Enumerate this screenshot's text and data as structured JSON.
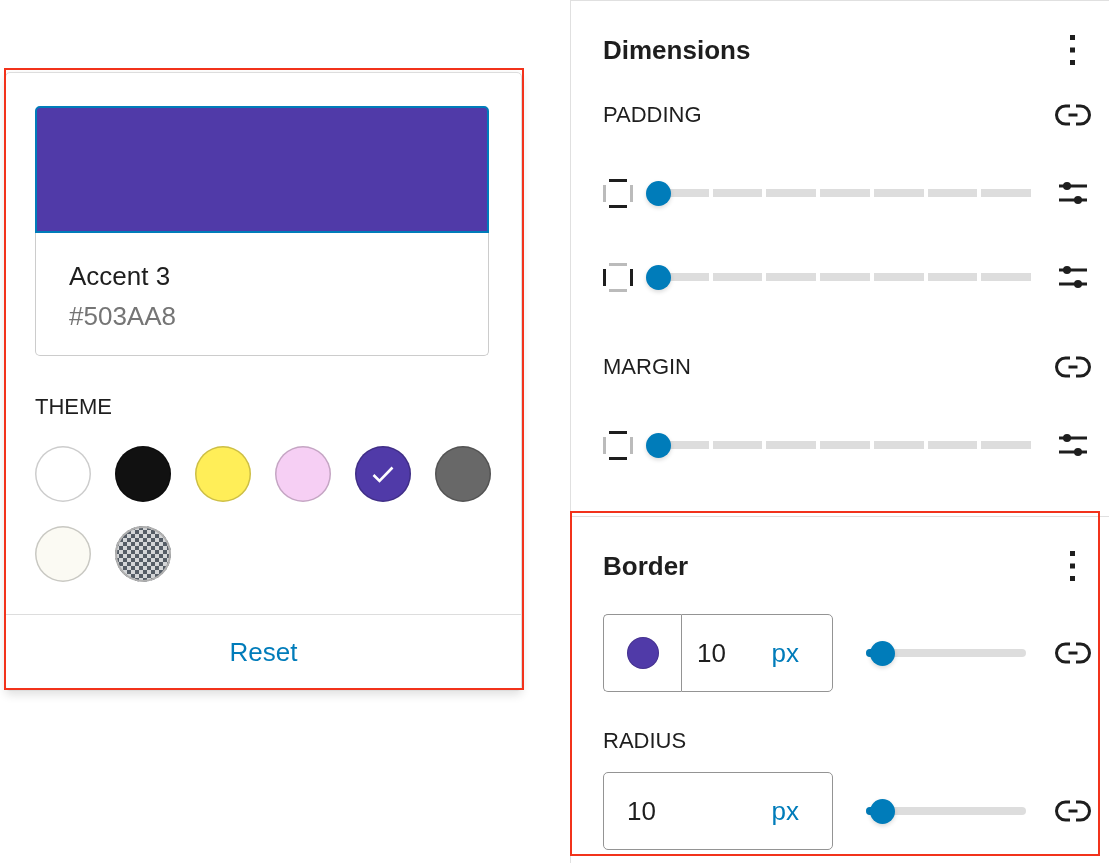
{
  "color_popover": {
    "highlighted": true,
    "preview": {
      "name": "Accent 3",
      "hex": "#503AA8"
    },
    "palette": {
      "label": "THEME",
      "swatches": [
        {
          "kind": "solid",
          "color": "#ffffff",
          "selected": false
        },
        {
          "kind": "solid",
          "color": "#111111",
          "selected": false
        },
        {
          "kind": "solid",
          "color": "#ffee58",
          "selected": false
        },
        {
          "kind": "solid",
          "color": "#f6cff4",
          "selected": false
        },
        {
          "kind": "solid",
          "color": "#503aa8",
          "selected": true
        },
        {
          "kind": "solid",
          "color": "#686868",
          "selected": false
        },
        {
          "kind": "solid",
          "color": "#fbfaf3",
          "selected": false
        },
        {
          "kind": "transparent",
          "selected": false
        }
      ]
    },
    "reset_button": "Reset"
  },
  "dimensions_panel": {
    "title": "Dimensions",
    "groups": [
      {
        "label": "PADDING",
        "rows": [
          {
            "kind": "vertical",
            "level": 0
          },
          {
            "kind": "horizontal",
            "level": 0
          }
        ]
      },
      {
        "label": "MARGIN",
        "rows": [
          {
            "kind": "vertical",
            "level": 0
          }
        ]
      }
    ]
  },
  "border_panel": {
    "title": "Border",
    "highlighted": true,
    "width": {
      "color": "#503aa8",
      "value": "10",
      "unit": "px",
      "level": 0.1
    },
    "radius": {
      "label": "RADIUS",
      "value": "10",
      "unit": "px",
      "level": 0.1
    }
  }
}
